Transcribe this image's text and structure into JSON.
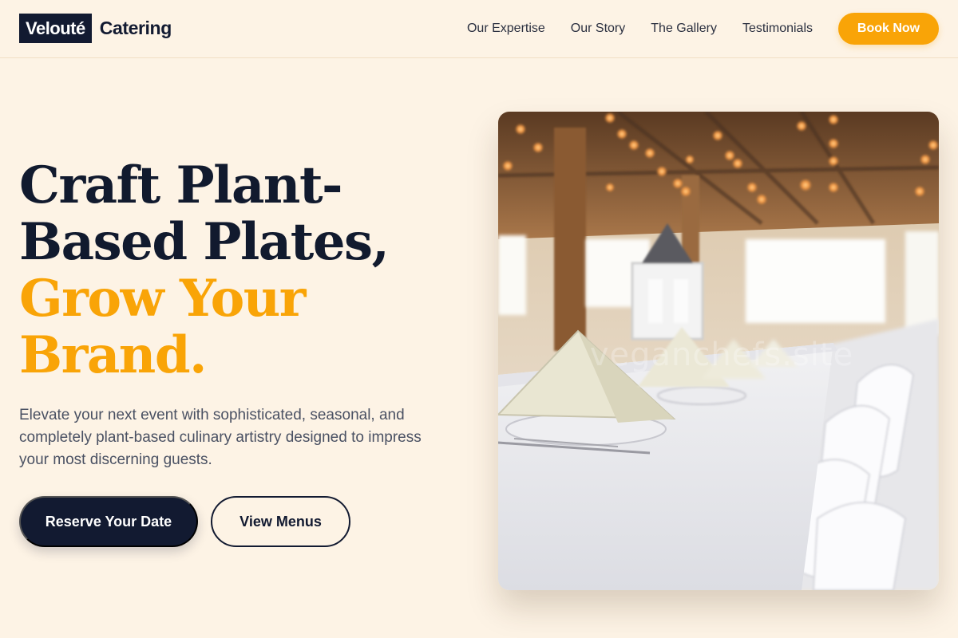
{
  "header": {
    "logo_box": "Velouté",
    "logo_text": "Catering",
    "nav": [
      "Our Expertise",
      "Our Story",
      "The Gallery",
      "Testimonials"
    ],
    "book_button": "Book Now"
  },
  "hero": {
    "headline_lines": [
      "Craft Plant-",
      "Based Plates,"
    ],
    "headline_accent_lines": [
      "Grow Your",
      "Brand."
    ],
    "subtext": "Elevate your next event with sophisticated, seasonal, and completely plant-based culinary artistry designed to impress your most discerning guests.",
    "primary_cta": "Reserve Your Date",
    "secondary_cta": "View Menus",
    "image_watermark": "veganchefs.site"
  },
  "colors": {
    "background": "#fdf3e5",
    "navy": "#121a31",
    "accent": "#f9a407",
    "body_text": "#4a5163"
  }
}
